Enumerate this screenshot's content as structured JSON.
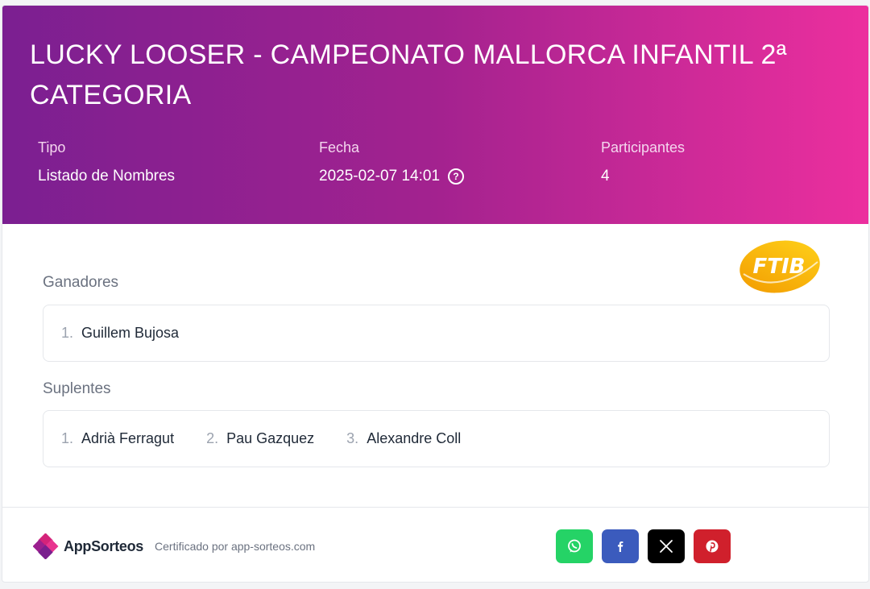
{
  "header": {
    "title": "LUCKY LOOSER - CAMPEONATO MALLORCA INFANTIL 2ª CATEGORIA",
    "tipo": {
      "label": "Tipo",
      "value": "Listado de Nombres"
    },
    "fecha": {
      "label": "Fecha",
      "value": "2025-02-07 14:01"
    },
    "participantes": {
      "label": "Participantes",
      "value": "4"
    }
  },
  "logo": {
    "text": "FTIB"
  },
  "winners": {
    "label": "Ganadores",
    "items": [
      {
        "num": "1.",
        "name": "Guillem Bujosa"
      }
    ]
  },
  "substitutes": {
    "label": "Suplentes",
    "items": [
      {
        "num": "1.",
        "name": "Adrià Ferragut"
      },
      {
        "num": "2.",
        "name": "Pau Gazquez"
      },
      {
        "num": "3.",
        "name": "Alexandre Coll"
      }
    ]
  },
  "footer": {
    "brand": "AppSorteos",
    "certified": "Certificado por app-sorteos.com",
    "share": [
      {
        "name": "whatsapp",
        "icon": "whatsapp-icon",
        "color": "#25d366"
      },
      {
        "name": "facebook",
        "icon": "facebook-icon",
        "color": "#3b5bbd"
      },
      {
        "name": "x",
        "icon": "x-icon",
        "color": "#000000"
      },
      {
        "name": "pinterest",
        "icon": "pinterest-icon",
        "color": "#d0202c"
      }
    ]
  },
  "colors": {
    "gradient_start": "#7b1f91",
    "gradient_end": "#ec2f9e"
  }
}
